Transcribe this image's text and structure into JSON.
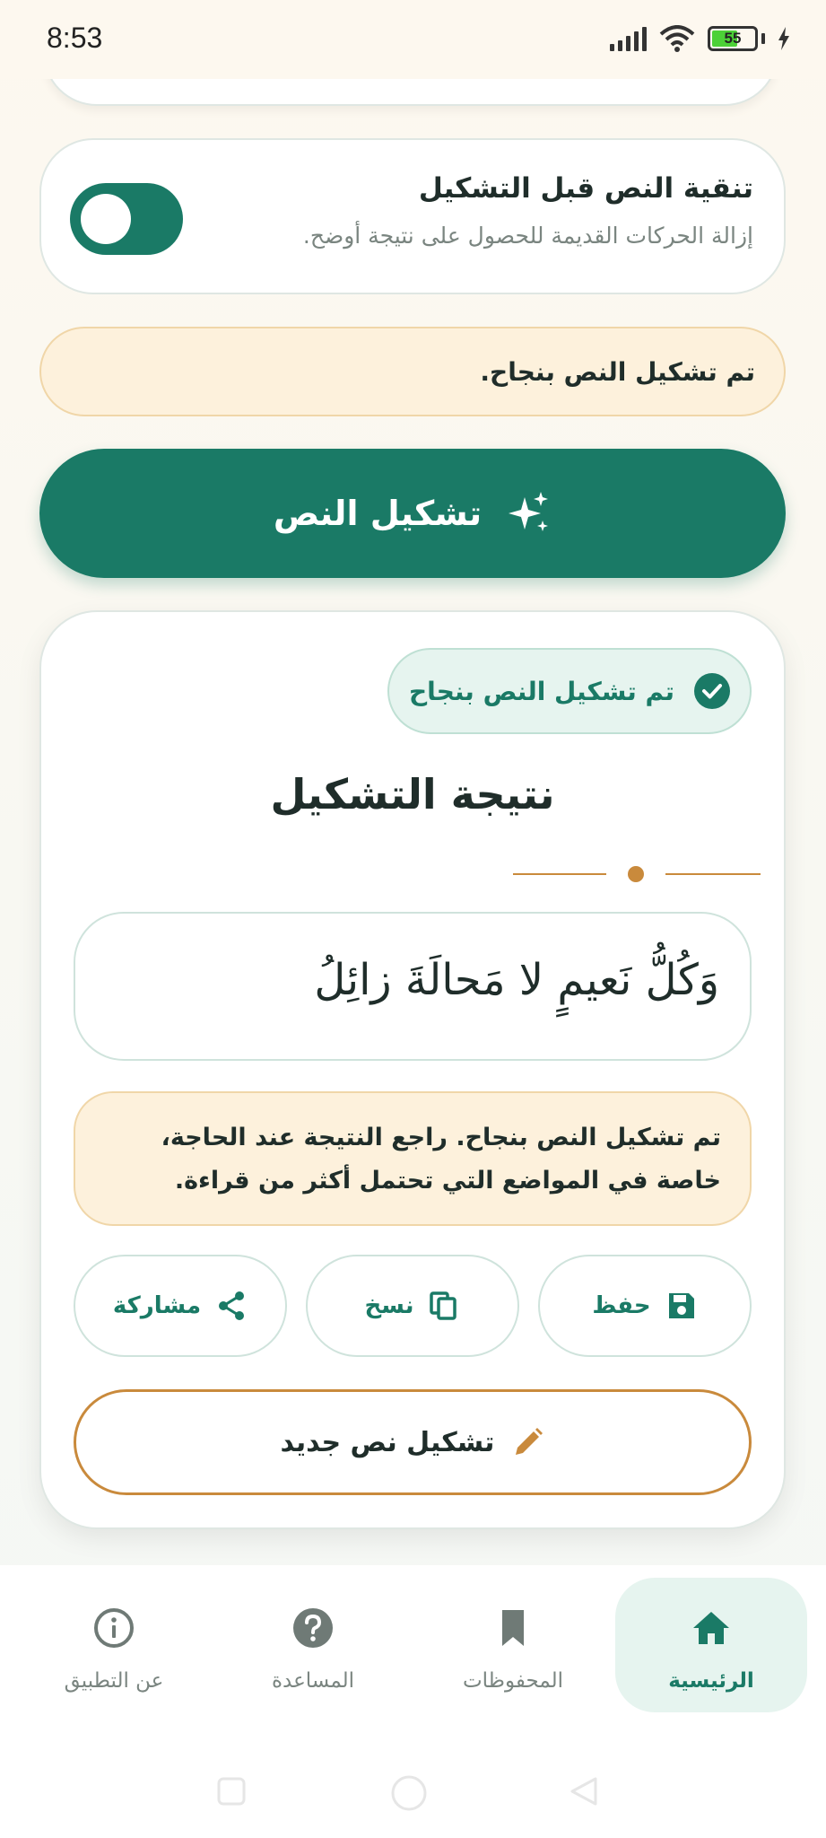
{
  "status_bar": {
    "time": "8:53",
    "battery": "55"
  },
  "settings": {
    "cleanup_title": "تنقية النص قبل التشكيل",
    "cleanup_subtitle": "إزالة الحركات القديمة للحصول على نتيجة أوضح.",
    "cleanup_enabled": true
  },
  "info_banner": "تم تشكيل النص بنجاح.",
  "main_action_label": "تشكيل النص",
  "result": {
    "badge": "تم تشكيل النص بنجاح",
    "title": "نتيجة التشكيل",
    "text": "وَكُلُّ نَعيمٍ لا مَحالَةَ زائِلُ",
    "note": "تم تشكيل النص بنجاح. راجع النتيجة عند الحاجة، خاصة في المواضع التي تحتمل أكثر من قراءة.",
    "actions": {
      "save": "حفظ",
      "copy": "نسخ",
      "share": "مشاركة"
    },
    "new_label": "تشكيل نص جديد"
  },
  "bottom_nav": {
    "home": "الرئيسية",
    "saved": "المحفوظات",
    "help": "المساعدة",
    "about": "عن التطبيق",
    "active": "home"
  },
  "colors": {
    "primary": "#1a7a66",
    "accent": "#c98a3c",
    "warning_bg": "#fdf1dc"
  }
}
